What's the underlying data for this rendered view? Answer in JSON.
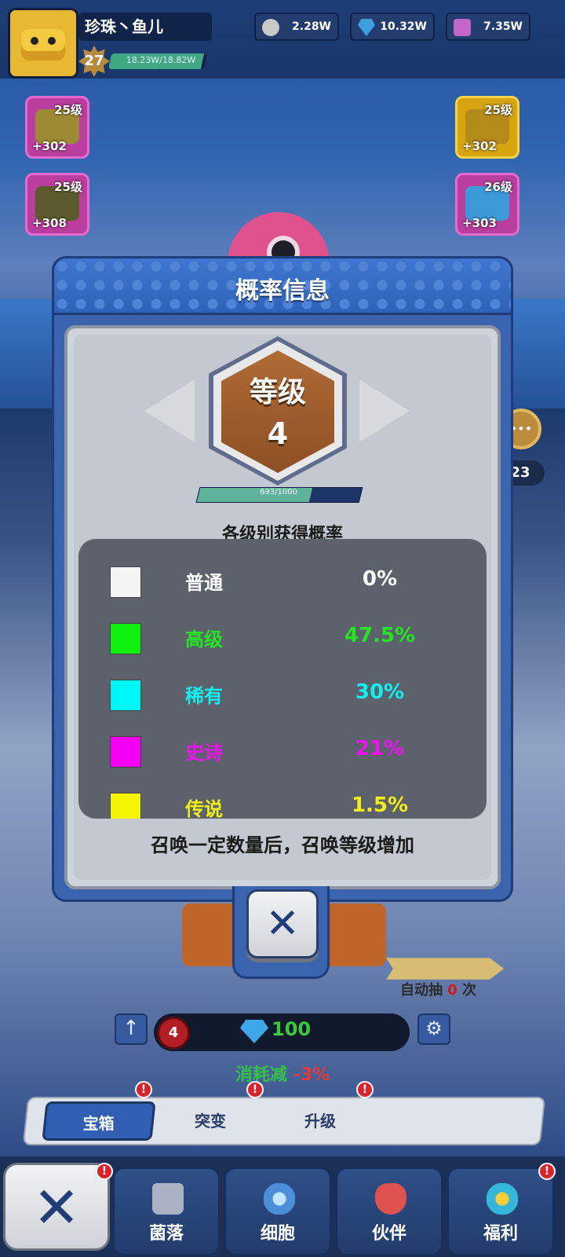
{
  "player": {
    "name": "珍珠丶鱼儿",
    "level": "27",
    "exp_text": "18.23W/18.82W",
    "exp_fraction": 0.97
  },
  "resources": [
    {
      "icon": "coin-icon",
      "value": "2.28W"
    },
    {
      "icon": "diamond-icon",
      "value": "10.32W"
    },
    {
      "icon": "chest-icon",
      "value": "7.35W"
    }
  ],
  "side_items_left": [
    {
      "level": "25级",
      "bonus": "+302"
    },
    {
      "level": "25级",
      "bonus": "+308"
    }
  ],
  "side_items_right": [
    {
      "level": "25级",
      "bonus": "+302"
    },
    {
      "level": "26级",
      "bonus": "+303"
    }
  ],
  "side_count": "23",
  "modal": {
    "title": "概率信息",
    "level_label": "等级",
    "level_value": "4",
    "progress_text": "693/1000",
    "progress_fraction": 0.693,
    "subtitle": "各级别获得概率",
    "rates": [
      {
        "name": "普通",
        "value": "0%",
        "color": "#f4f4f4",
        "text_color": "#ffffff"
      },
      {
        "name": "高级",
        "value": "47.5%",
        "color": "#0ff00f",
        "text_color": "#22e622"
      },
      {
        "name": "稀有",
        "value": "30%",
        "color": "#00f7f7",
        "text_color": "#11f0f0"
      },
      {
        "name": "史诗",
        "value": "21%",
        "color": "#f400f4",
        "text_color": "#f012f0"
      },
      {
        "name": "传说",
        "value": "1.5%",
        "color": "#f4f400",
        "text_color": "#f0f014"
      }
    ],
    "footer_note": "召唤一定数量后，召唤等级增加",
    "close_icon": "close-icon"
  },
  "summon": {
    "auto_prefix": "自动抽",
    "auto_count": "0",
    "auto_suffix": "次",
    "summon_level": "4",
    "cost": "100",
    "discount_label": "消耗减",
    "discount_value": "-3%"
  },
  "tabs": [
    {
      "label": "宝箱",
      "active": true,
      "badge": "!"
    },
    {
      "label": "突变",
      "active": false,
      "badge": "!"
    },
    {
      "label": "升级",
      "active": false,
      "badge": "!"
    }
  ],
  "bottom_nav": [
    {
      "label": "菌落",
      "icon": "lock-icon"
    },
    {
      "label": "细胞",
      "icon": "cell-icon"
    },
    {
      "label": "伙伴",
      "icon": "partner-icon"
    },
    {
      "label": "福利",
      "icon": "gift-icon",
      "badge": "!"
    }
  ],
  "nav_close_badge": "!",
  "colors": {
    "modal_blue": "#3a64ae",
    "panel_gray": "#cfd3da",
    "accent_green": "#35c04a",
    "alert_red": "#d8242a"
  }
}
